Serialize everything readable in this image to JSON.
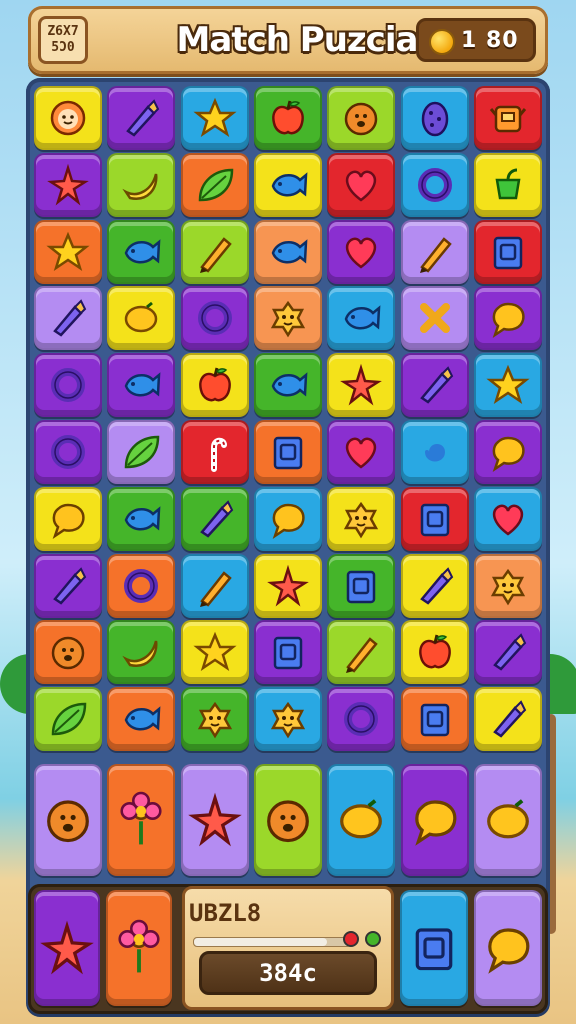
{
  "header": {
    "level_line1": "Z6X7",
    "level_line2": "5Ɔ0",
    "title": "Match Puzcia",
    "coins": "1  80"
  },
  "colors": {
    "yellow": "#f4e21a",
    "purple": "#8a2fd0",
    "green": "#45b52a",
    "orange": "#f5722a",
    "red": "#e3262d",
    "blue": "#29a8e3",
    "lavender": "#b48cf2",
    "lime": "#9bd82a",
    "peach": "#f79552"
  },
  "grid": [
    [
      {
        "color": "yellow",
        "icon": "sun-face"
      },
      {
        "color": "purple",
        "icon": "crayon"
      },
      {
        "color": "blue",
        "icon": "star"
      },
      {
        "color": "green",
        "icon": "apple"
      },
      {
        "color": "lime",
        "icon": "lion-face"
      },
      {
        "color": "blue",
        "icon": "egg"
      },
      {
        "color": "red",
        "icon": "robot"
      }
    ],
    [
      {
        "color": "purple",
        "icon": "starfish"
      },
      {
        "color": "lime",
        "icon": "banana"
      },
      {
        "color": "orange",
        "icon": "leaf"
      },
      {
        "color": "yellow",
        "icon": "fish"
      },
      {
        "color": "red",
        "icon": "heart"
      },
      {
        "color": "blue",
        "icon": "ring"
      },
      {
        "color": "yellow",
        "icon": "pot"
      }
    ],
    [
      {
        "color": "orange",
        "icon": "star"
      },
      {
        "color": "green",
        "icon": "fish"
      },
      {
        "color": "lime",
        "icon": "pencil"
      },
      {
        "color": "peach",
        "icon": "fish"
      },
      {
        "color": "purple",
        "icon": "heart"
      },
      {
        "color": "lavender",
        "icon": "pencil"
      },
      {
        "color": "red",
        "icon": "box"
      }
    ],
    [
      {
        "color": "lavender",
        "icon": "crayon"
      },
      {
        "color": "yellow",
        "icon": "lemon"
      },
      {
        "color": "purple",
        "icon": "ring"
      },
      {
        "color": "peach",
        "icon": "cookie"
      },
      {
        "color": "blue",
        "icon": "fish"
      },
      {
        "color": "lavender",
        "icon": "cross"
      },
      {
        "color": "purple",
        "icon": "bubble"
      }
    ],
    [
      {
        "color": "purple",
        "icon": "ring"
      },
      {
        "color": "purple",
        "icon": "fish"
      },
      {
        "color": "yellow",
        "icon": "apple"
      },
      {
        "color": "green",
        "icon": "fish"
      },
      {
        "color": "yellow",
        "icon": "starfish"
      },
      {
        "color": "purple",
        "icon": "crayon"
      },
      {
        "color": "blue",
        "icon": "star"
      }
    ],
    [
      {
        "color": "purple",
        "icon": "ring"
      },
      {
        "color": "lavender",
        "icon": "leaf"
      },
      {
        "color": "red",
        "icon": "cane"
      },
      {
        "color": "orange",
        "icon": "box"
      },
      {
        "color": "purple",
        "icon": "heart"
      },
      {
        "color": "blue",
        "icon": "swirl"
      },
      {
        "color": "purple",
        "icon": "bubble"
      }
    ],
    [
      {
        "color": "yellow",
        "icon": "bubble"
      },
      {
        "color": "green",
        "icon": "fish"
      },
      {
        "color": "green",
        "icon": "crayon"
      },
      {
        "color": "blue",
        "icon": "bubble"
      },
      {
        "color": "yellow",
        "icon": "cookie"
      },
      {
        "color": "red",
        "icon": "box"
      },
      {
        "color": "blue",
        "icon": "heart"
      }
    ],
    [
      {
        "color": "purple",
        "icon": "crayon"
      },
      {
        "color": "orange",
        "icon": "ring"
      },
      {
        "color": "blue",
        "icon": "pencil"
      },
      {
        "color": "yellow",
        "icon": "starfish"
      },
      {
        "color": "green",
        "icon": "box"
      },
      {
        "color": "yellow",
        "icon": "crayon"
      },
      {
        "color": "peach",
        "icon": "cookie"
      }
    ],
    [
      {
        "color": "orange",
        "icon": "lion-face"
      },
      {
        "color": "green",
        "icon": "banana"
      },
      {
        "color": "yellow",
        "icon": "star"
      },
      {
        "color": "purple",
        "icon": "box"
      },
      {
        "color": "lime",
        "icon": "pencil"
      },
      {
        "color": "yellow",
        "icon": "apple"
      },
      {
        "color": "purple",
        "icon": "crayon"
      }
    ],
    [
      {
        "color": "lime",
        "icon": "leaf"
      },
      {
        "color": "orange",
        "icon": "fish"
      },
      {
        "color": "green",
        "icon": "cookie"
      },
      {
        "color": "blue",
        "icon": "cookie"
      },
      {
        "color": "purple",
        "icon": "ring"
      },
      {
        "color": "orange",
        "icon": "box"
      },
      {
        "color": "yellow",
        "icon": "crayon"
      }
    ]
  ],
  "big_row": [
    {
      "color": "lavender",
      "icon": "lion-face"
    },
    {
      "color": "orange",
      "icon": "flower"
    },
    {
      "color": "lavender",
      "icon": "starfish"
    },
    {
      "color": "lime",
      "icon": "lion-face"
    },
    {
      "color": "blue",
      "icon": "lemon"
    },
    {
      "color": "purple",
      "icon": "bubble"
    },
    {
      "color": "lavender",
      "icon": "lemon"
    }
  ],
  "footer": {
    "left_tiles": [
      {
        "color": "purple",
        "icon": "starfish"
      },
      {
        "color": "orange",
        "icon": "flower"
      }
    ],
    "right_tiles": [
      {
        "color": "blue",
        "icon": "box"
      },
      {
        "color": "lavender",
        "icon": "bubble"
      }
    ],
    "label": "UBZL8",
    "score": "384c",
    "progress": 0.85
  }
}
